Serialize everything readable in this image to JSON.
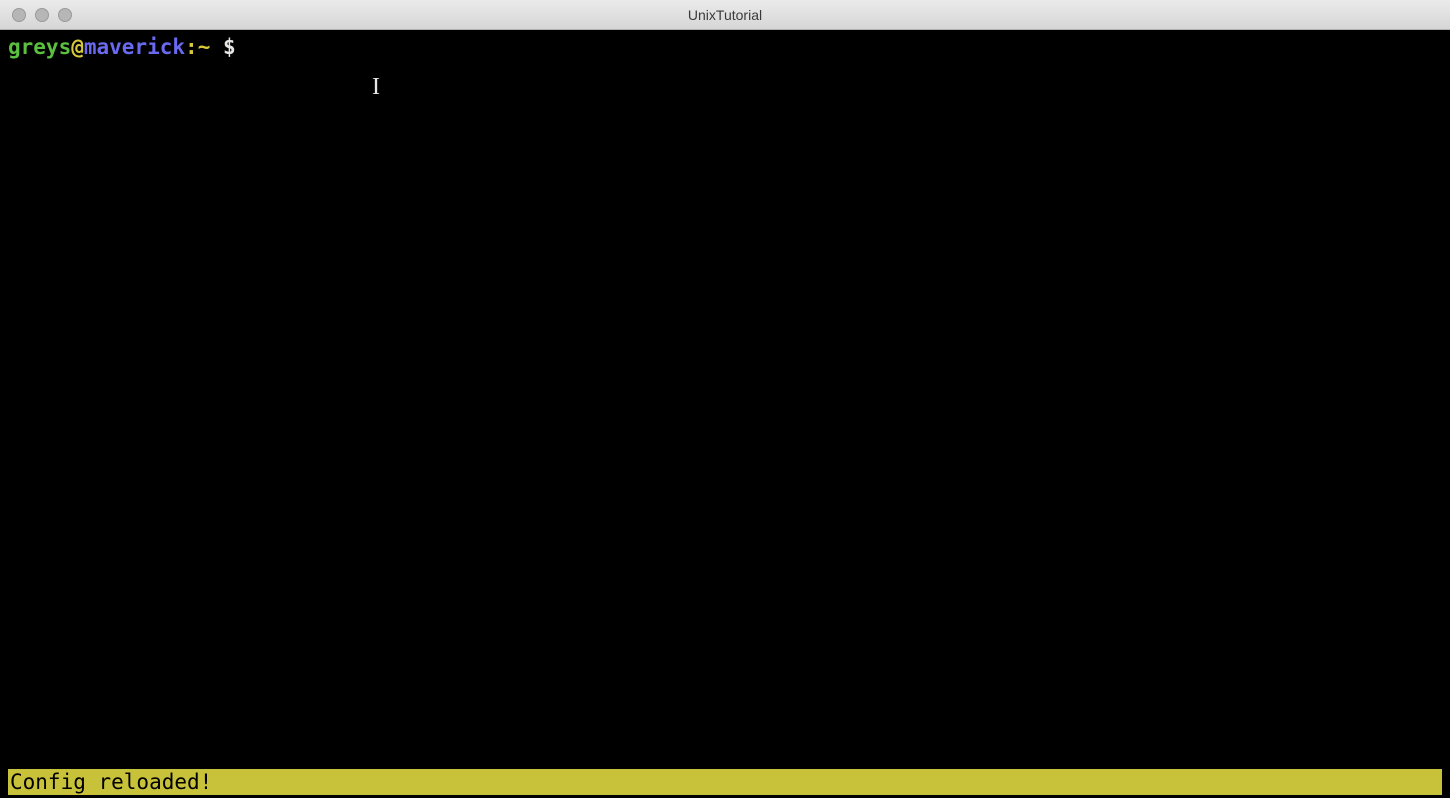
{
  "window": {
    "title": "UnixTutorial"
  },
  "prompt": {
    "user": "greys",
    "at": "@",
    "host": "maverick",
    "colon": ":",
    "path": "~",
    "symbol": " $ "
  },
  "status": {
    "message": "Config reloaded!"
  },
  "cursor": {
    "glyph": "I"
  }
}
